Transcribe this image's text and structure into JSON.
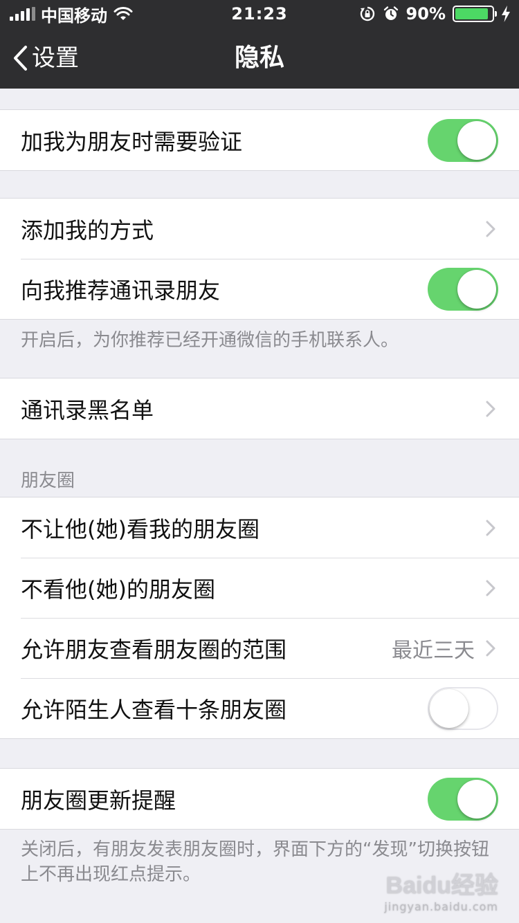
{
  "status_bar": {
    "carrier": "中国移动",
    "time": "21:23",
    "battery_percent": "90%",
    "battery_level": 0.9,
    "battery_color": "#4cd964",
    "icons": [
      "signal-icon",
      "wifi-icon",
      "rotation-lock-icon",
      "alarm-icon",
      "battery-icon",
      "charging-bolt-icon"
    ]
  },
  "nav": {
    "back_label": "设置",
    "title": "隐私"
  },
  "groups": {
    "verify": {
      "label": "加我为朋友时需要验证",
      "toggle_on": true
    },
    "contacts": {
      "add_me_label": "添加我的方式",
      "recommend_label": "向我推荐通讯录朋友",
      "recommend_on": true,
      "footnote": "开启后，为你推荐已经开通微信的手机联系人。"
    },
    "blacklist": {
      "label": "通讯录黑名单"
    },
    "moments": {
      "header": "朋友圈",
      "block_label": "不让他(她)看我的朋友圈",
      "hide_label": "不看他(她)的朋友圈",
      "range_label": "允许朋友查看朋友圈的范围",
      "range_value": "最近三天",
      "stranger_label": "允许陌生人查看十条朋友圈",
      "stranger_on": false
    },
    "update": {
      "label": "朋友圈更新提醒",
      "toggle_on": true,
      "footnote": "关闭后，有朋友发表朋友圈时，界面下方的“发现”切换按钮上不再出现红点提示。"
    }
  },
  "colors": {
    "nav_bg": "#2e2e30",
    "toggle_on": "#66d46e",
    "page_bg": "#efeff4"
  },
  "watermark": {
    "logo": "Baidu经验",
    "url": "jingyan.baidu.com"
  }
}
